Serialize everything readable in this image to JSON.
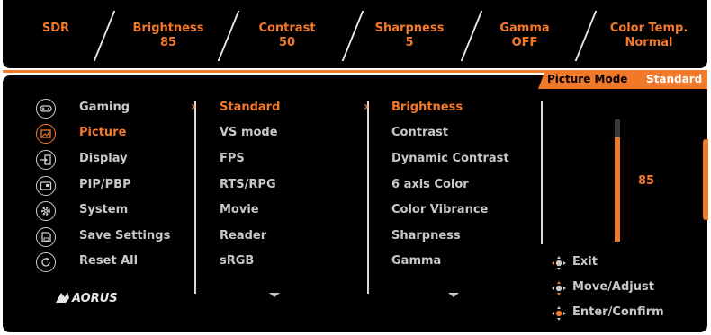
{
  "status_bar": {
    "items": [
      {
        "label": "SDR",
        "value": ""
      },
      {
        "label": "Brightness",
        "value": "85"
      },
      {
        "label": "Contrast",
        "value": "50"
      },
      {
        "label": "Sharpness",
        "value": "5"
      },
      {
        "label": "Gamma",
        "value": "OFF"
      },
      {
        "label": "Color Temp.",
        "value": "Normal"
      }
    ]
  },
  "picture_mode": {
    "label": "Picture Mode",
    "value": "Standard"
  },
  "categories": [
    {
      "label": "Gaming",
      "icon": "gamepad-icon"
    },
    {
      "label": "Picture",
      "icon": "picture-icon"
    },
    {
      "label": "Display",
      "icon": "display-input-icon"
    },
    {
      "label": "PIP/PBP",
      "icon": "pip-icon"
    },
    {
      "label": "System",
      "icon": "gear-icon"
    },
    {
      "label": "Save Settings",
      "icon": "save-icon"
    },
    {
      "label": "Reset All",
      "icon": "reset-icon"
    }
  ],
  "active_category": "Picture",
  "picture_modes": [
    "Standard",
    "VS mode",
    "FPS",
    "RTS/RPG",
    "Movie",
    "Reader",
    "sRGB"
  ],
  "active_picture_mode": "Standard",
  "settings": [
    "Brightness",
    "Contrast",
    "Dynamic Contrast",
    "6 axis Color",
    "Color Vibrance",
    "Sharpness",
    "Gamma"
  ],
  "active_setting": "Brightness",
  "slider": {
    "value": "85",
    "level_percent": 85
  },
  "hints": [
    {
      "label": "Exit",
      "icon": "dpad-left-icon"
    },
    {
      "label": "Move/Adjust",
      "icon": "dpad-updown-icon"
    },
    {
      "label": "Enter/Confirm",
      "icon": "dpad-center-icon"
    }
  ],
  "brand": {
    "logo": "AORUS"
  },
  "colors": {
    "accent": "#f3792a",
    "text": "#c8c8c8",
    "background": "#000000"
  }
}
